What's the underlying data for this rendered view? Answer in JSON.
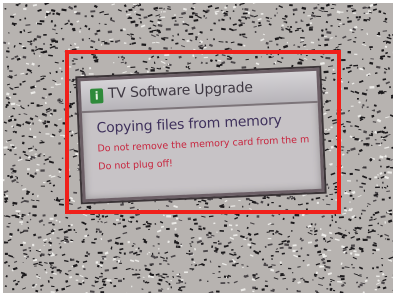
{
  "dialog": {
    "title": "TV Software Upgrade",
    "icon": "info-icon",
    "status": "Copying  files from memory",
    "warnings": [
      "Do not remove the memory card from the m",
      "Do not plug off!"
    ]
  },
  "colors": {
    "highlight": "#f0201a",
    "icon_green": "#2e8a3a",
    "warning_red": "#c7253e",
    "status_text": "#3f315c"
  }
}
